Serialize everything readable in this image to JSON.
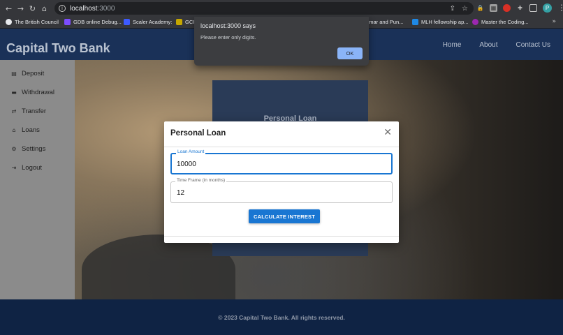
{
  "browser": {
    "url_host": "localhost",
    "url_port": ":3000",
    "bookmarks": [
      {
        "label": "The British Council",
        "color": "#e8eaed"
      },
      {
        "label": "GDB online Debug...",
        "color": "#7c4dff"
      },
      {
        "label": "Scaler Academy:",
        "color": "#3d5afe"
      },
      {
        "label": "GCI",
        "color": "#c6a700"
      },
      {
        "label": "mmar and Pun...",
        "color": "#35363a"
      },
      {
        "label": "MLH fellowship ap...",
        "color": "#1e88e5"
      },
      {
        "label": "Master the Coding...",
        "color": "#9c27b0"
      }
    ],
    "profile_initial": "P"
  },
  "alert": {
    "title": "localhost:3000 says",
    "message": "Please enter only digits.",
    "ok_label": "OK"
  },
  "site": {
    "brand": "Capital Two Bank",
    "nav": [
      "Home",
      "About",
      "Contact Us"
    ],
    "sidebar": [
      {
        "label": "Deposit",
        "icon": "deposit-icon",
        "glyph": "▤"
      },
      {
        "label": "Withdrawal",
        "icon": "withdrawal-icon",
        "glyph": "▬"
      },
      {
        "label": "Transfer",
        "icon": "transfer-icon",
        "glyph": "⇄"
      },
      {
        "label": "Loans",
        "icon": "bank-icon",
        "glyph": "⌂"
      },
      {
        "label": "Settings",
        "icon": "gear-icon",
        "glyph": "⚙"
      },
      {
        "label": "Logout",
        "icon": "logout-icon",
        "glyph": "⇥"
      }
    ],
    "card_title": "Personal Loan",
    "footer": "© 2023 Capital Two Bank. All rights reserved."
  },
  "modal": {
    "title": "Personal Loan",
    "loan_amount_label": "Loan Amount",
    "loan_amount_value": "10000",
    "time_frame_label": "Time Frame (in months)",
    "time_frame_value": "12",
    "button_label": "CALCULATE INTEREST"
  }
}
